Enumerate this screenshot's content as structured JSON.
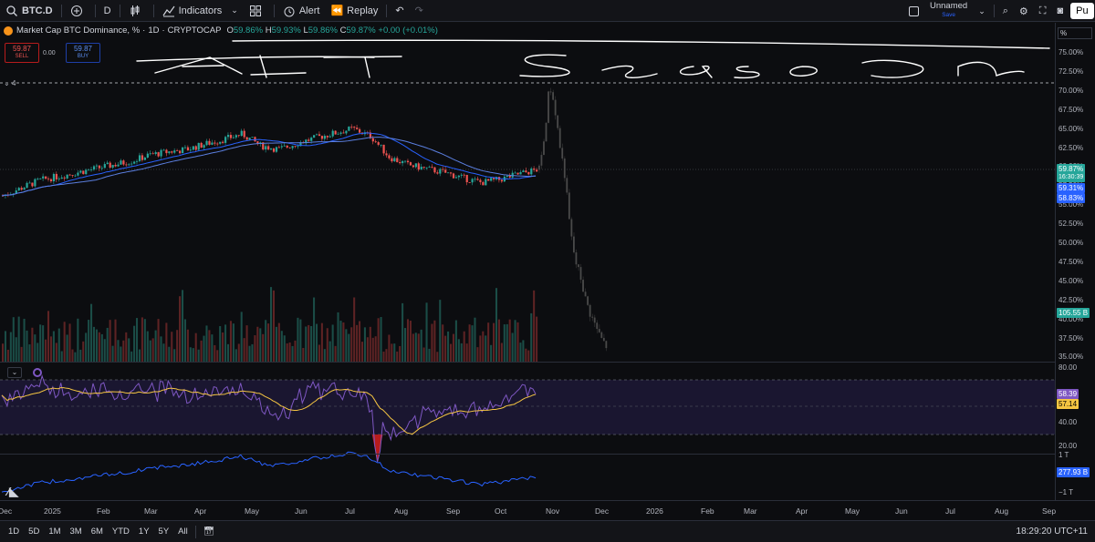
{
  "toolbar": {
    "symbol": "BTC.D",
    "interval": "D",
    "indicators_label": "Indicators",
    "alert_label": "Alert",
    "replay_label": "Replay",
    "layout_name": "Unnamed",
    "save_label": "Save",
    "publish_label": "Pu"
  },
  "legend": {
    "title": "Market Cap BTC Dominance, %",
    "interval": "1D",
    "source": "CRYPTOCAP",
    "open_label": "O",
    "open": "59.86%",
    "high_label": "H",
    "high": "59.93%",
    "low_label": "L",
    "low": "59.86%",
    "close_label": "C",
    "close": "59.87%",
    "change": "+0.00 (+0.01%)",
    "sell_price": "59.87",
    "sell_label": "SELL",
    "buy_price": "59.87",
    "buy_label": "BUY",
    "spread": "0.00",
    "badge_count": "4"
  },
  "annotation": {
    "text": "ALT Season"
  },
  "price_axis": {
    "unit": "%",
    "ticks": [
      "75.00%",
      "72.50%",
      "70.00%",
      "67.50%",
      "65.00%",
      "62.50%",
      "60.00%",
      "57.50%",
      "55.00%",
      "52.50%",
      "50.00%",
      "47.50%",
      "45.00%",
      "42.50%",
      "40.00%",
      "37.50%",
      "35.00%"
    ],
    "last_price": "59.87%",
    "countdown": "16:30:39",
    "ma1": "59.31%",
    "ma2": "58.83%",
    "volume": "105.55 B"
  },
  "rsi_axis": {
    "ticks": [
      "80.00",
      "60.00",
      "40.00",
      "20.00"
    ],
    "rsi": "58.39",
    "rsi_ma": "57.14"
  },
  "mc_axis": {
    "top": "1 T",
    "bottom": "−1 T",
    "value": "277.93 B"
  },
  "time_axis": [
    "Dec",
    "2025",
    "Feb",
    "Mar",
    "Apr",
    "May",
    "Jun",
    "Jul",
    "Aug",
    "Sep",
    "Oct",
    "Nov",
    "Dec",
    "2026",
    "Feb",
    "Mar",
    "Apr",
    "May",
    "Jun",
    "Jul",
    "Aug",
    "Sep"
  ],
  "bottom_bar": {
    "ranges": [
      "1D",
      "5D",
      "1M",
      "3M",
      "6M",
      "YTD",
      "1Y",
      "5Y",
      "All"
    ],
    "clock": "18:29:20 UTC+11"
  },
  "colors": {
    "up": "#26a69a",
    "down": "#ef5350",
    "ma": "#2962ff",
    "rsi": "#7e57c2",
    "rsi_ma": "#f5c542",
    "projection": "#4a4a4a"
  },
  "chart_data": {
    "type": "line",
    "title": "Market Cap BTC Dominance, %",
    "ylabel": "%",
    "ylim": [
      35,
      75
    ],
    "series": [
      {
        "values": [
          56.5,
          57.5,
          58.5,
          59,
          59.5,
          60,
          60.5,
          61,
          61.8,
          62.2,
          62.5,
          63.2,
          63.8,
          64.5,
          63,
          62.5,
          63.3,
          64,
          64.6,
          65.2,
          64.2,
          61.5,
          60.5,
          60,
          59.5,
          58.8,
          58.2,
          58.6,
          59.3,
          59.87
        ]
      },
      {
        "values": [
          59.87,
          64,
          71,
          68,
          63,
          59,
          52,
          48,
          46,
          43,
          41,
          39.5,
          38,
          37
        ]
      }
    ]
  }
}
